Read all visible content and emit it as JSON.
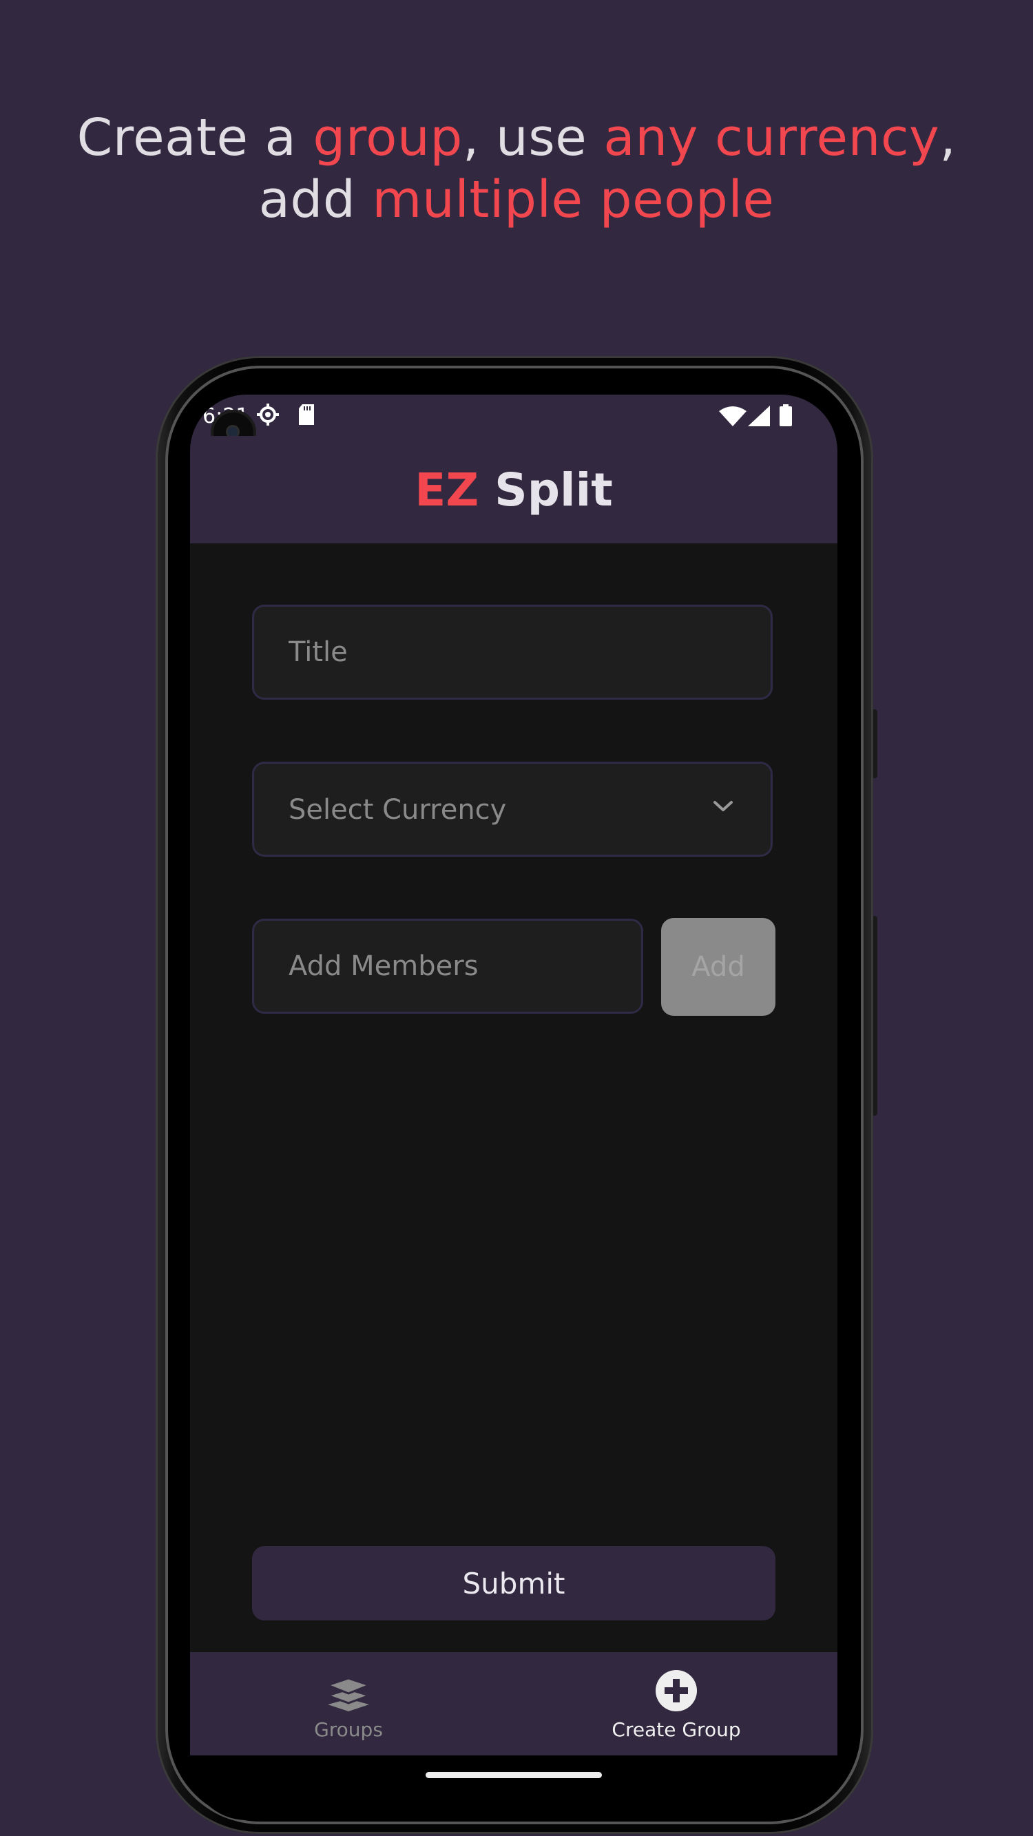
{
  "headline": {
    "line1": [
      {
        "text": "Create a ",
        "accent": false
      },
      {
        "text": "group",
        "accent": true
      },
      {
        "text": ", use ",
        "accent": false
      },
      {
        "text": "any currency",
        "accent": true
      },
      {
        "text": ",",
        "accent": false
      }
    ],
    "line2": [
      {
        "text": "add ",
        "accent": false
      },
      {
        "text": "multiple people",
        "accent": true
      }
    ]
  },
  "status_bar": {
    "time": "6:21",
    "icons": [
      "settings-icon",
      "sd-card-icon",
      "wifi-icon",
      "signal-icon",
      "battery-icon"
    ]
  },
  "app_bar": {
    "title_accent": "EZ",
    "title_rest": " Split"
  },
  "form": {
    "title_placeholder": "Title",
    "currency_placeholder": "Select Currency",
    "members_placeholder": "Add Members",
    "add_button": "Add",
    "submit_button": "Submit"
  },
  "bottom_nav": {
    "items": [
      {
        "label": "Groups",
        "icon": "layers-icon",
        "active": false
      },
      {
        "label": "Create Group",
        "icon": "add-circle-icon",
        "active": true
      }
    ]
  },
  "colors": {
    "background": "#322840",
    "accent": "#f2474f",
    "surface": "#141414",
    "field": "#1e1e1e",
    "disabled_button": "#8a8a8a"
  }
}
